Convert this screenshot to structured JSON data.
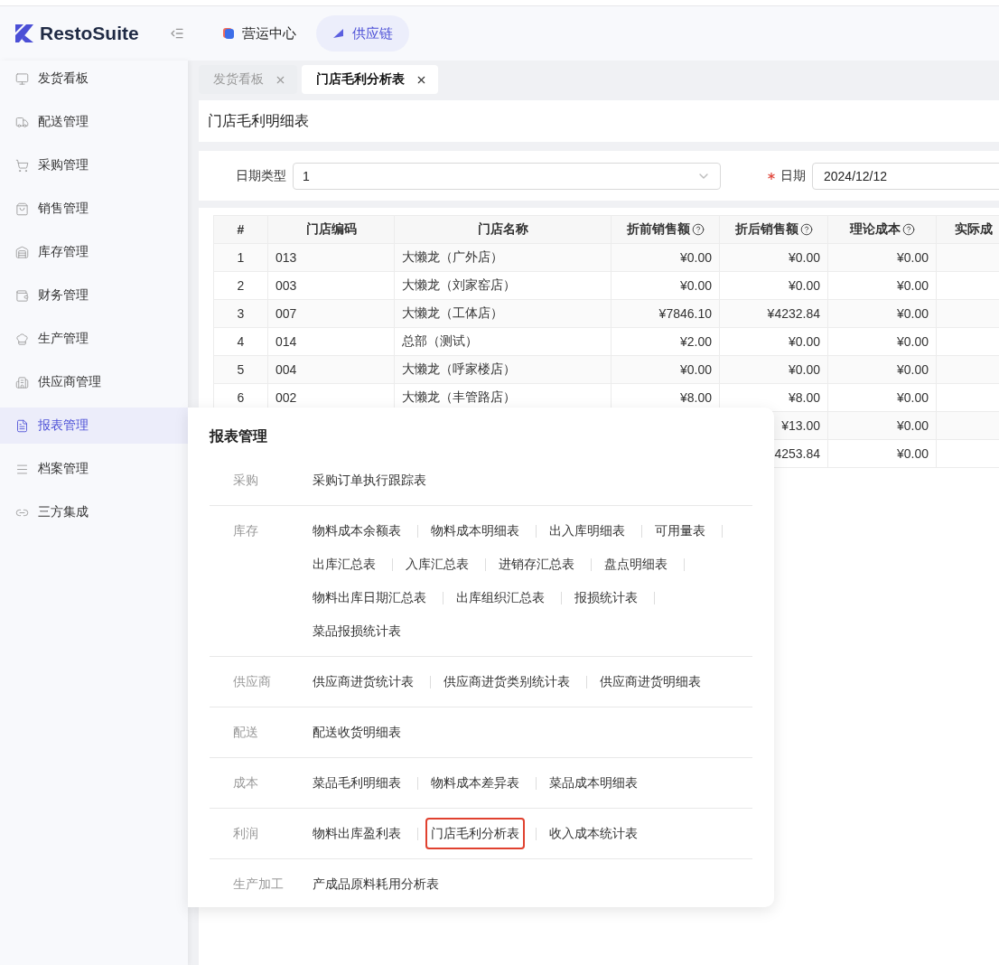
{
  "header": {
    "logo": "RestoSuite",
    "modules": [
      {
        "label": "营运中心",
        "selected": false
      },
      {
        "label": "供应链",
        "selected": true
      }
    ]
  },
  "sidebar": {
    "items": [
      {
        "label": "发货看板",
        "selected": false
      },
      {
        "label": "配送管理",
        "selected": false
      },
      {
        "label": "采购管理",
        "selected": false
      },
      {
        "label": "销售管理",
        "selected": false
      },
      {
        "label": "库存管理",
        "selected": false
      },
      {
        "label": "财务管理",
        "selected": false
      },
      {
        "label": "生产管理",
        "selected": false
      },
      {
        "label": "供应商管理",
        "selected": false
      },
      {
        "label": "报表管理",
        "selected": true
      },
      {
        "label": "档案管理",
        "selected": false
      },
      {
        "label": "三方集成",
        "selected": false
      }
    ]
  },
  "page_tabs": [
    {
      "label": "发货看板",
      "selected": false
    },
    {
      "label": "门店毛利分析表",
      "selected": true
    }
  ],
  "page_title": "门店毛利明细表",
  "filters": [
    {
      "kind": "select",
      "label": "日期类型",
      "required": false,
      "value": "1"
    },
    {
      "kind": "date",
      "label": "日期",
      "required": true,
      "value": "2024/12/12"
    }
  ],
  "table": {
    "columns": [
      {
        "label": "#",
        "hint": false
      },
      {
        "label": "门店编码",
        "hint": false
      },
      {
        "label": "门店名称",
        "hint": false
      },
      {
        "label": "折前销售额",
        "hint": true
      },
      {
        "label": "折后销售额",
        "hint": true
      },
      {
        "label": "理论成本",
        "hint": true
      },
      {
        "label": "实际成",
        "hint": false
      }
    ],
    "rows": [
      {
        "cells": [
          "1",
          "013",
          "大懒龙（广外店）",
          "¥0.00",
          "¥0.00",
          "¥0.00"
        ]
      },
      {
        "cells": [
          "2",
          "003",
          "大懒龙（刘家窑店）",
          "¥0.00",
          "¥0.00",
          "¥0.00"
        ]
      },
      {
        "cells": [
          "3",
          "007",
          "大懒龙（工体店）",
          "¥7846.10",
          "¥4232.84",
          "¥0.00"
        ]
      },
      {
        "cells": [
          "4",
          "014",
          "总部（测试）",
          "¥2.00",
          "¥0.00",
          "¥0.00"
        ]
      },
      {
        "cells": [
          "5",
          "004",
          "大懒龙（呼家楼店）",
          "¥0.00",
          "¥0.00",
          "¥0.00"
        ]
      },
      {
        "cells": [
          "6",
          "002",
          "大懒龙（丰管路店）",
          "¥8.00",
          "¥8.00",
          "¥0.00"
        ]
      },
      {
        "cells": [
          null,
          null,
          null,
          null,
          "¥13.00",
          "¥0.00"
        ]
      },
      {
        "cells": [
          null,
          null,
          null,
          null,
          "4253.84",
          "¥0.00"
        ]
      }
    ]
  },
  "report_menu": {
    "title": "报表管理",
    "sections": [
      {
        "label": "采购",
        "items": [
          {
            "label": "采购订单执行跟踪表",
            "selected": false
          }
        ]
      },
      {
        "label": "库存",
        "items": [
          {
            "label": "物料成本余额表",
            "selected": false
          },
          {
            "label": "物料成本明细表",
            "selected": false
          },
          {
            "label": "出入库明细表",
            "selected": false
          },
          {
            "label": "可用量表",
            "selected": false
          },
          {
            "label": "出库汇总表",
            "selected": false
          },
          {
            "label": "入库汇总表",
            "selected": false
          },
          {
            "label": "进销存汇总表",
            "selected": false
          },
          {
            "label": "盘点明细表",
            "selected": false
          },
          {
            "label": "物料出库日期汇总表",
            "selected": false
          },
          {
            "label": "出库组织汇总表",
            "selected": false
          },
          {
            "label": "报损统计表",
            "selected": false
          },
          {
            "label": "菜品报损统计表",
            "selected": false
          }
        ]
      },
      {
        "label": "供应商",
        "items": [
          {
            "label": "供应商进货统计表",
            "selected": false
          },
          {
            "label": "供应商进货类别统计表",
            "selected": false
          },
          {
            "label": "供应商进货明细表",
            "selected": false
          }
        ]
      },
      {
        "label": "配送",
        "items": [
          {
            "label": "配送收货明细表",
            "selected": false
          }
        ]
      },
      {
        "label": "成本",
        "items": [
          {
            "label": "菜品毛利明细表",
            "selected": false
          },
          {
            "label": "物料成本差异表",
            "selected": false
          },
          {
            "label": "菜品成本明细表",
            "selected": false
          }
        ]
      },
      {
        "label": "利润",
        "items": [
          {
            "label": "物料出库盈利表",
            "selected": false
          },
          {
            "label": "门店毛利分析表",
            "selected": true
          },
          {
            "label": "收入成本统计表",
            "selected": false
          }
        ]
      },
      {
        "label": "生产加工",
        "items": [
          {
            "label": "产成品原料耗用分析表",
            "selected": false
          }
        ]
      }
    ]
  }
}
